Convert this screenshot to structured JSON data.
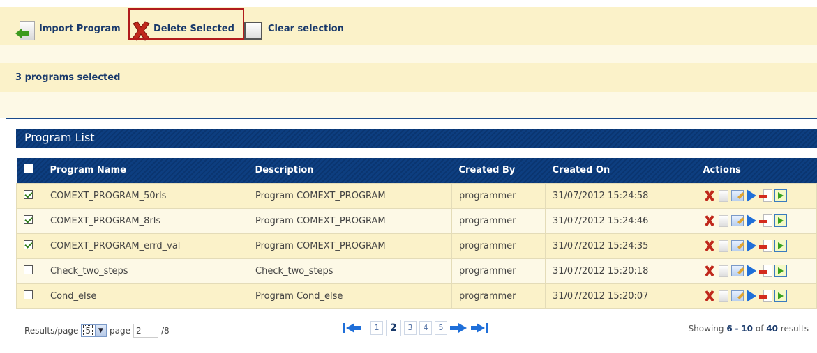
{
  "toolbar": {
    "import_label": "Import Program",
    "delete_label": "Delete Selected",
    "clear_label": "Clear selection"
  },
  "status": {
    "text": "3 programs selected"
  },
  "panel": {
    "title": "Program List"
  },
  "table": {
    "headers": [
      "Program Name",
      "Description",
      "Created By",
      "Created On",
      "Actions"
    ],
    "rows": [
      {
        "checked": true,
        "name": "COMEXT_PROGRAM_50rls",
        "description": "Program COMEXT_PROGRAM",
        "created_by": "programmer",
        "created_on": "31/07/2012 15:24:58"
      },
      {
        "checked": true,
        "name": "COMEXT_PROGRAM_8rls",
        "description": "Program COMEXT_PROGRAM",
        "created_by": "programmer",
        "created_on": "31/07/2012 15:24:46"
      },
      {
        "checked": true,
        "name": "COMEXT_PROGRAM_errd_val",
        "description": "Program COMEXT_PROGRAM",
        "created_by": "programmer",
        "created_on": "31/07/2012 15:24:35"
      },
      {
        "checked": false,
        "name": "Check_two_steps",
        "description": "Check_two_steps",
        "created_by": "programmer",
        "created_on": "31/07/2012 15:20:18"
      },
      {
        "checked": false,
        "name": "Cond_else",
        "description": "Program Cond_else",
        "created_by": "programmer",
        "created_on": "31/07/2012 15:20:07"
      }
    ],
    "action_icons": [
      "delete-icon",
      "document-icon",
      "edit-icon",
      "run-icon",
      "export-icon",
      "move-icon"
    ]
  },
  "pagination": {
    "results_label": "Results/page",
    "results_value": "5",
    "page_label": "page",
    "page_value": "2",
    "page_total": "/8",
    "pages": [
      "1",
      "2",
      "3",
      "4",
      "5"
    ],
    "current_page": "2",
    "showing_prefix": "Showing",
    "showing_from": "6",
    "showing_sep": "-",
    "showing_to": "10",
    "showing_of": "of",
    "showing_total": "40",
    "showing_suffix": "results"
  },
  "colors": {
    "header_blue": "#0d3e80",
    "toolbar_bg": "#fbf2c9",
    "highlight_red": "#b11c1c",
    "link_blue": "#1a3a6b"
  }
}
